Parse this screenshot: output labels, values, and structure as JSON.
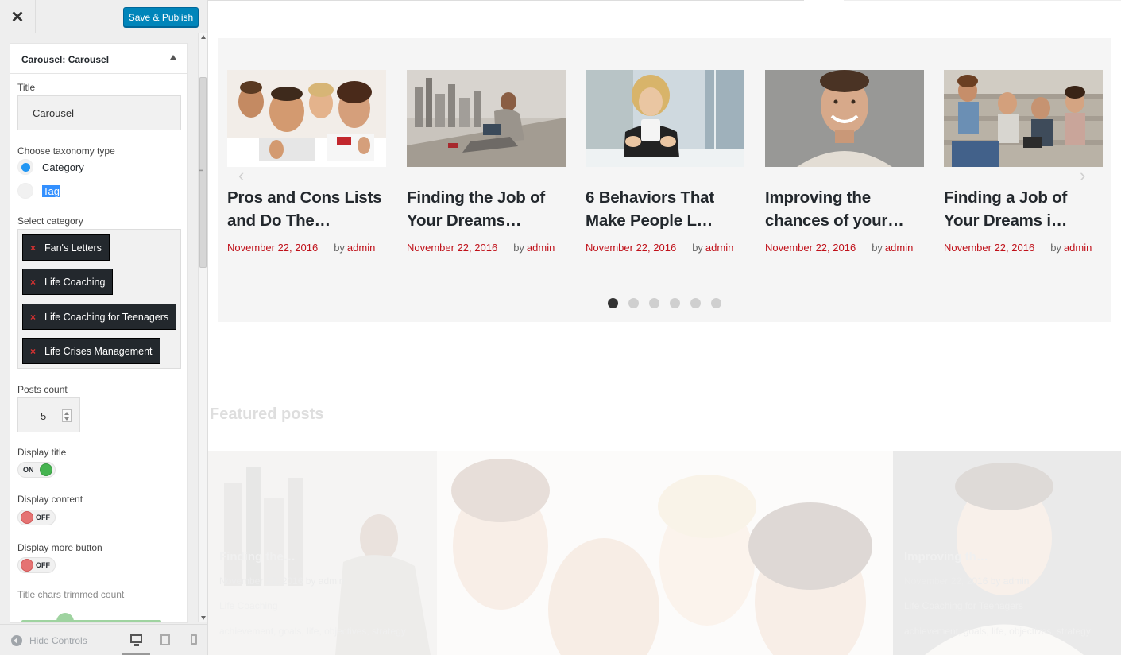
{
  "header": {
    "close_icon": "close-icon",
    "publish_label": "Save & Publish"
  },
  "widget": {
    "type_label": "Carousel:",
    "name_label": "Carousel"
  },
  "title_field": {
    "label": "Title",
    "value": "Carousel"
  },
  "taxonomy": {
    "label": "Choose taxonomy type",
    "options": [
      {
        "label": "Category",
        "checked": true
      },
      {
        "label": "Tag",
        "checked": false
      }
    ]
  },
  "categories": {
    "label": "Select category",
    "remove_glyph": "×",
    "items": [
      "Fan's Letters",
      "Life Coaching",
      "Life Coaching for Teenagers",
      "Life Crises Management"
    ]
  },
  "posts_count": {
    "label": "Posts count",
    "value": "5"
  },
  "display_title": {
    "label": "Display title",
    "state": "ON"
  },
  "display_content": {
    "label": "Display content",
    "state": "OFF"
  },
  "display_more": {
    "label": "Display more button",
    "state": "OFF"
  },
  "trim_count": {
    "label": "Title chars trimmed count"
  },
  "footer": {
    "hide_controls": "Hide Controls"
  },
  "carousel": {
    "posts": [
      {
        "title": "Pros and Cons Lists and Do The…",
        "date": "November 22, 2016",
        "by": "by",
        "author": "admin"
      },
      {
        "title": "Finding the Job of Your Dreams…",
        "date": "November 22, 2016",
        "by": "by",
        "author": "admin"
      },
      {
        "title": "6 Behaviors That Make People L…",
        "date": "November 22, 2016",
        "by": "by",
        "author": "admin"
      },
      {
        "title": "Improving the chances of your…",
        "date": "November 22, 2016",
        "by": "by",
        "author": "admin"
      },
      {
        "title": "Finding a Job of Your Dreams i…",
        "date": "November 22, 2016",
        "by": "by",
        "author": "admin"
      }
    ],
    "prev_arrow": "‹",
    "next_arrow": "›",
    "dot_count": 6,
    "active_dot": 0
  },
  "featured": {
    "heading": "Featured posts",
    "tiles": [
      {
        "title": "Finding the…",
        "date": "November 22, 2016",
        "by": "by",
        "author": "admin",
        "category": "Life Coaching",
        "tags": "achievement, goals, life, objectives, strategy"
      },
      {
        "title": "Improving th…",
        "date": "November 22, 2016",
        "by": "by",
        "author": "admin",
        "category": "Life Coaching for Teenagers",
        "tags": "achievement, goals, life, objectives, strategy"
      }
    ]
  },
  "colors": {
    "accent": "#0085ba",
    "link": "#c0111a",
    "chip": "#23282d",
    "toggle_on": "#46b450",
    "toggle_off": "#e57373"
  }
}
